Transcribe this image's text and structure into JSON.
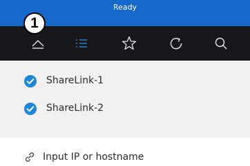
{
  "status": {
    "text": "Ready"
  },
  "annotation": {
    "badge": "1"
  },
  "tabs": [
    {
      "icon": "chevron-up-icon",
      "active": false
    },
    {
      "icon": "list-icon",
      "active": true
    },
    {
      "icon": "star-icon",
      "active": false
    },
    {
      "icon": "refresh-icon",
      "active": false
    },
    {
      "icon": "search-icon",
      "active": false
    }
  ],
  "list": {
    "items": [
      {
        "label": "ShareLink-1",
        "checked": true
      },
      {
        "label": "ShareLink-2",
        "checked": true
      }
    ]
  },
  "input": {
    "placeholder": "Input IP or hostname",
    "value": "",
    "icon": "link-icon"
  },
  "colors": {
    "accent": "#1668c9",
    "tab_bar": "#16181c",
    "list_bg": "#f1f1f1",
    "check": "#1d86d8"
  }
}
